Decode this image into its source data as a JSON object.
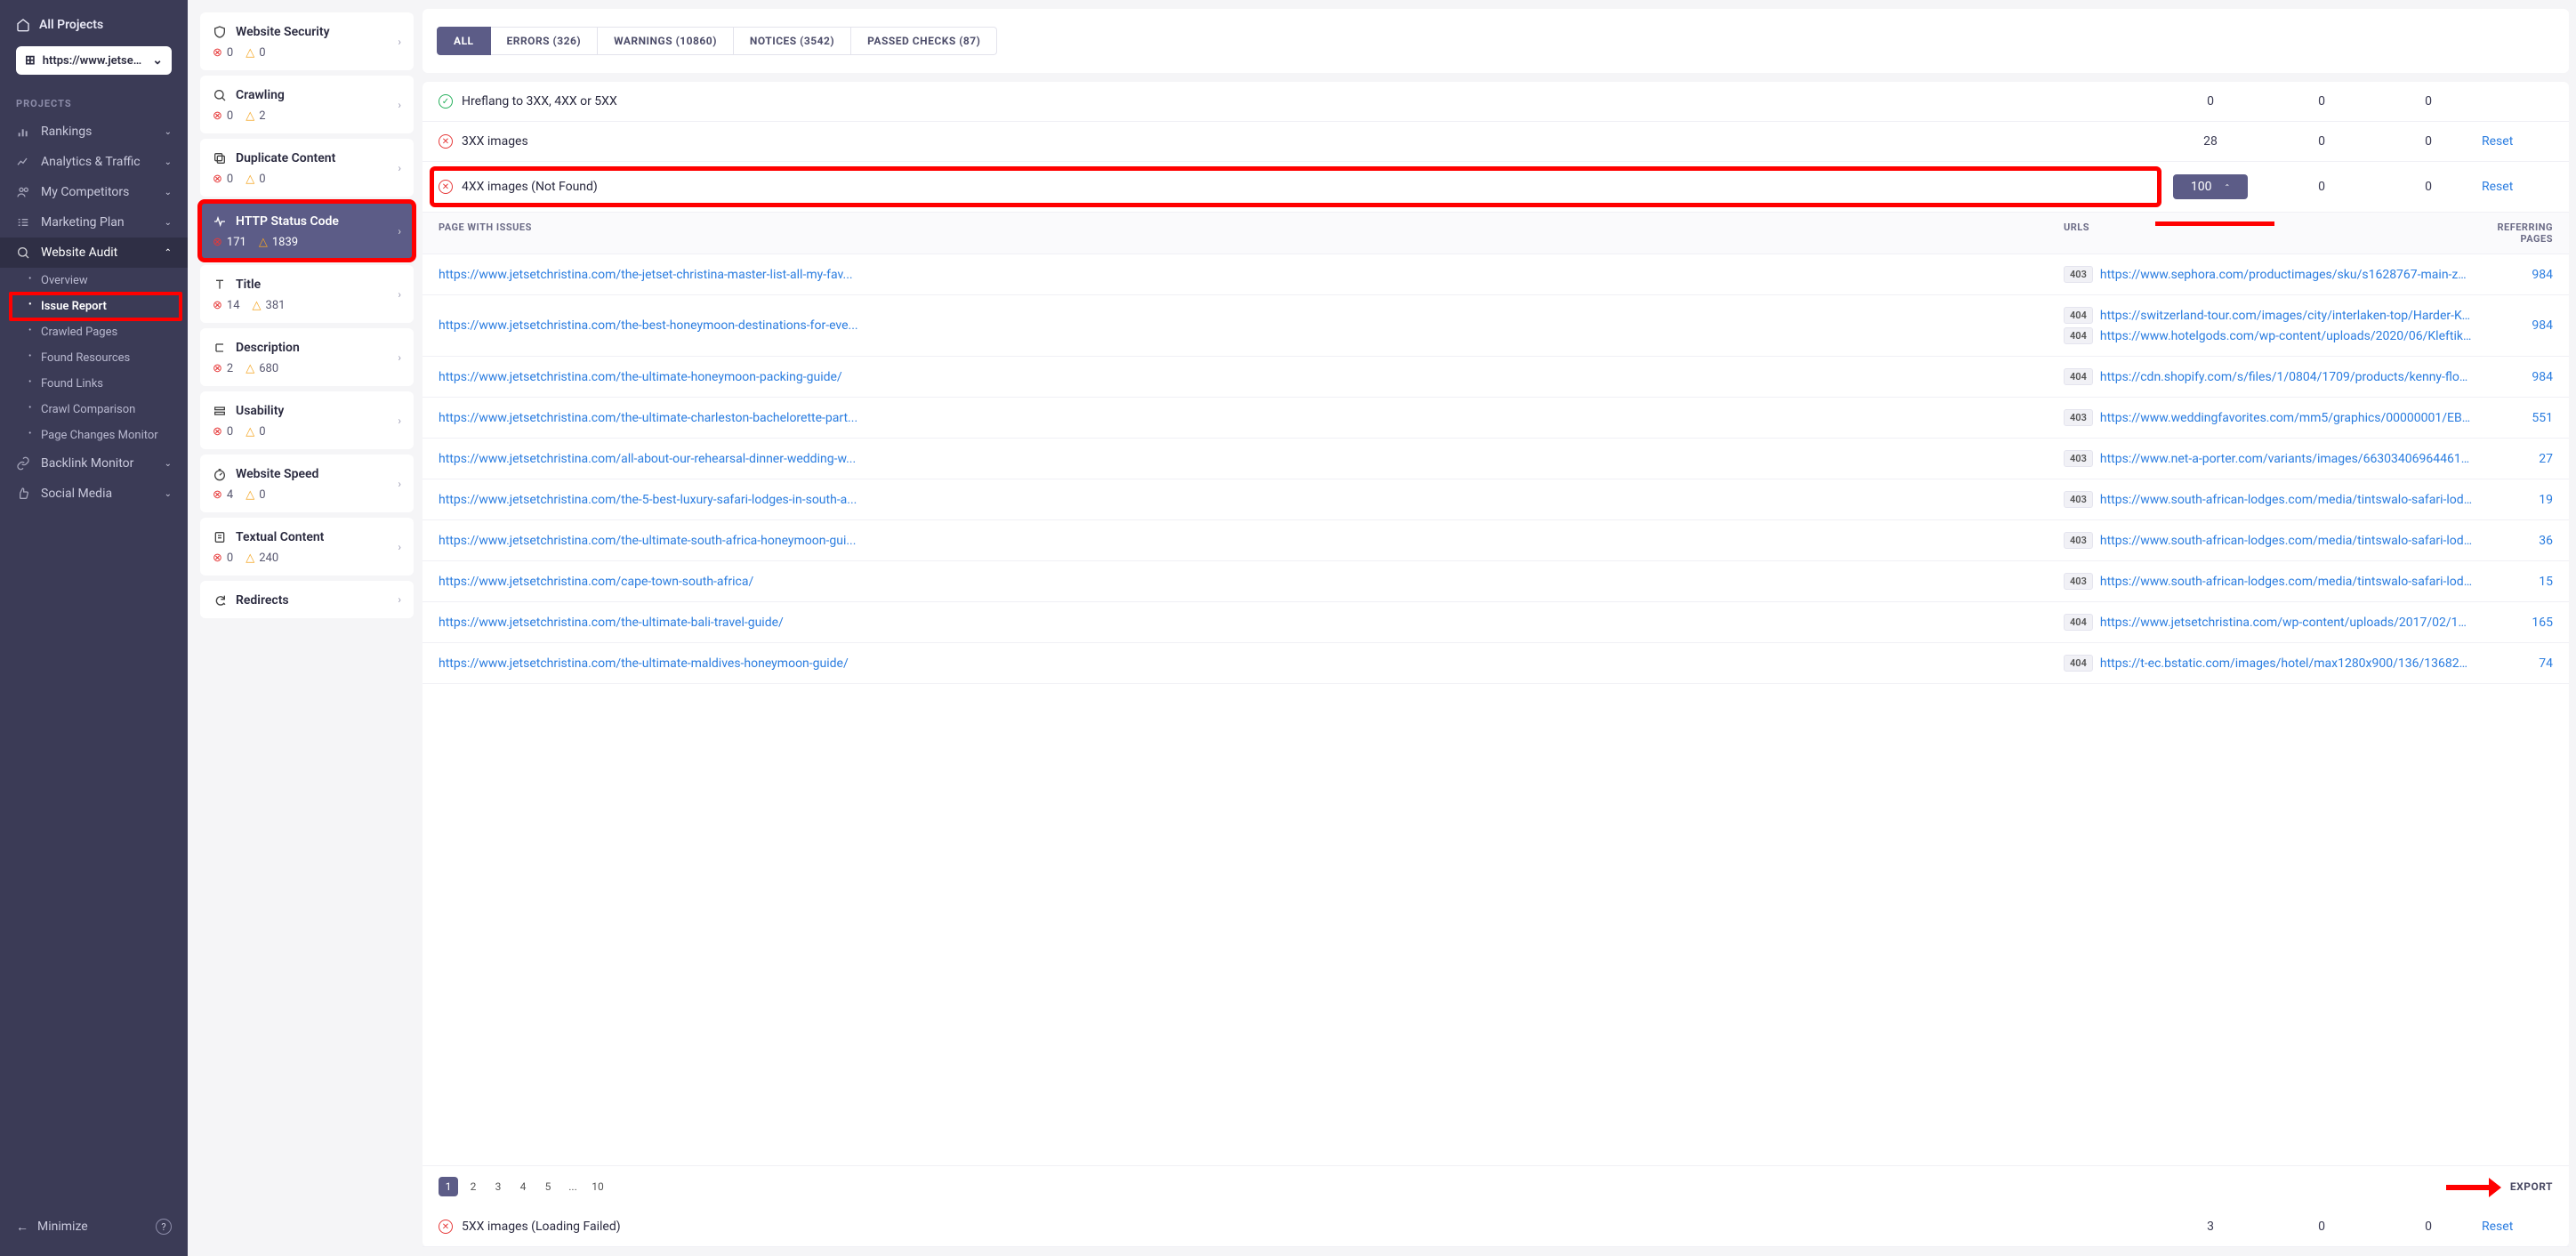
{
  "sidebar": {
    "all_projects": "All Projects",
    "project_url": "https://www.jetsetchr...",
    "section_label": "PROJECTS",
    "nav": {
      "rankings": "Rankings",
      "analytics": "Analytics & Traffic",
      "competitors": "My Competitors",
      "marketing": "Marketing Plan",
      "audit": "Website Audit",
      "backlink": "Backlink Monitor",
      "social": "Social Media"
    },
    "audit_sub": {
      "overview": "Overview",
      "issue_report": "Issue Report",
      "crawled_pages": "Crawled Pages",
      "found_resources": "Found Resources",
      "found_links": "Found Links",
      "crawl_comparison": "Crawl Comparison",
      "page_changes": "Page Changes Monitor"
    },
    "minimize": "Minimize"
  },
  "categories": [
    {
      "id": "security",
      "name": "Website Security",
      "errors": 0,
      "warnings": 0
    },
    {
      "id": "crawling",
      "name": "Crawling",
      "errors": 0,
      "warnings": 2
    },
    {
      "id": "duplicate",
      "name": "Duplicate Content",
      "errors": 0,
      "warnings": 0
    },
    {
      "id": "http",
      "name": "HTTP Status Code",
      "errors": 171,
      "warnings": 1839
    },
    {
      "id": "title",
      "name": "Title",
      "errors": 14,
      "warnings": 381
    },
    {
      "id": "description",
      "name": "Description",
      "errors": 2,
      "warnings": 680
    },
    {
      "id": "usability",
      "name": "Usability",
      "errors": 0,
      "warnings": 0
    },
    {
      "id": "speed",
      "name": "Website Speed",
      "errors": 4,
      "warnings": 0
    },
    {
      "id": "textual",
      "name": "Textual Content",
      "errors": 0,
      "warnings": 240
    },
    {
      "id": "redirects",
      "name": "Redirects",
      "errors": null,
      "warnings": null
    }
  ],
  "tabs": [
    {
      "label": "ALL",
      "active": true
    },
    {
      "label": "ERRORS (326)",
      "active": false
    },
    {
      "label": "WARNINGS (10860)",
      "active": false
    },
    {
      "label": "NOTICES (3542)",
      "active": false
    },
    {
      "label": "PASSED CHECKS (87)",
      "active": false
    }
  ],
  "top_issues": {
    "hreflang": {
      "name": "Hreflang to 3XX, 4XX or 5XX",
      "c1": 0,
      "c2": 0,
      "c3": 0
    },
    "img3xx": {
      "name": "3XX images",
      "c1": 28,
      "c2": 0,
      "c3": 0,
      "reset": "Reset"
    },
    "img4xx": {
      "name": "4XX images (Not Found)",
      "c1": 100,
      "c2": 0,
      "c3": 0,
      "reset": "Reset"
    },
    "img5xx": {
      "name": "5XX images (Loading Failed)",
      "c1": 3,
      "c2": 0,
      "c3": 0,
      "reset": "Reset"
    }
  },
  "table": {
    "headers": {
      "page": "PAGE WITH ISSUES",
      "urls": "URLS",
      "ref": "REFERRING PAGES"
    },
    "rows": [
      {
        "page": "https://www.jetsetchristina.com/the-jetset-christina-master-list-all-my-fav...",
        "urls": [
          {
            "code": "403",
            "url": "https://www.sephora.com/productimages/sku/s1628767-main-zoom..."
          }
        ],
        "ref": 984
      },
      {
        "page": "https://www.jetsetchristina.com/the-best-honeymoon-destinations-for-eve...",
        "urls": [
          {
            "code": "404",
            "url": "https://switzerland-tour.com/images/city/interlaken-top/Harder-Kul..."
          },
          {
            "code": "404",
            "url": "https://www.hotelgods.com/wp-content/uploads/2020/06/Kleftiko..."
          }
        ],
        "ref": 984
      },
      {
        "page": "https://www.jetsetchristina.com/the-ultimate-honeymoon-packing-guide/",
        "urls": [
          {
            "code": "404",
            "url": "https://cdn.shopify.com/s/files/1/0804/1709/products/kenny-flower..."
          }
        ],
        "ref": 984
      },
      {
        "page": "https://www.jetsetchristina.com/the-ultimate-charleston-bachelorette-part...",
        "urls": [
          {
            "code": "403",
            "url": "https://www.weddingfavorites.com/mm5/graphics/00000001/EB33..."
          }
        ],
        "ref": 551
      },
      {
        "page": "https://www.jetsetchristina.com/all-about-our-rehearsal-dinner-wedding-w...",
        "urls": [
          {
            "code": "403",
            "url": "https://www.net-a-porter.com/variants/images/6630340696446107..."
          }
        ],
        "ref": 27
      },
      {
        "page": "https://www.jetsetchristina.com/the-5-best-luxury-safari-lodges-in-south-a...",
        "urls": [
          {
            "code": "403",
            "url": "https://www.south-african-lodges.com/media/tintswalo-safari-lodge..."
          }
        ],
        "ref": 19
      },
      {
        "page": "https://www.jetsetchristina.com/the-ultimate-south-africa-honeymoon-gui...",
        "urls": [
          {
            "code": "403",
            "url": "https://www.south-african-lodges.com/media/tintswalo-safari-lodge..."
          }
        ],
        "ref": 36
      },
      {
        "page": "https://www.jetsetchristina.com/cape-town-south-africa/",
        "urls": [
          {
            "code": "403",
            "url": "https://www.south-african-lodges.com/media/tintswalo-safari-lodge..."
          }
        ],
        "ref": 15
      },
      {
        "page": "https://www.jetsetchristina.com/the-ultimate-bali-travel-guide/",
        "urls": [
          {
            "code": "404",
            "url": "https://www.jetsetchristina.com/wp-content/uploads/2017/02/1Jets..."
          }
        ],
        "ref": 165
      },
      {
        "page": "https://www.jetsetchristina.com/the-ultimate-maldives-honeymoon-guide/",
        "urls": [
          {
            "code": "404",
            "url": "https://t-ec.bstatic.com/images/hotel/max1280x900/136/13682885..."
          }
        ],
        "ref": 74
      }
    ]
  },
  "pager": {
    "pages": [
      "1",
      "2",
      "3",
      "4",
      "5",
      "...",
      "10"
    ],
    "export": "EXPORT"
  }
}
